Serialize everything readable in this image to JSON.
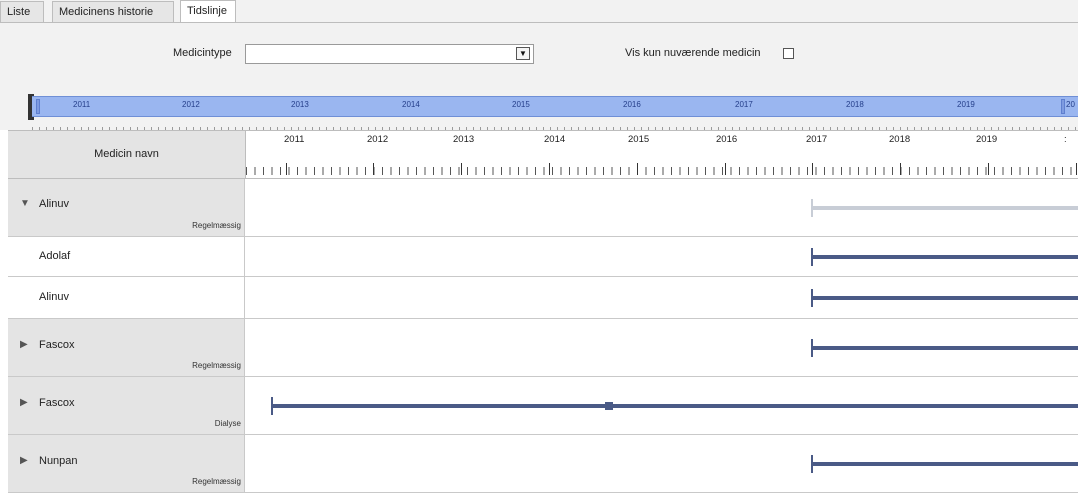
{
  "colors": {
    "bar_active": "#4a5a86",
    "bar_inactive": "#c8cdd6",
    "overview_fill": "#9ab6f0",
    "panel_bg": "#f2f2f2",
    "group_label_bg": "#e4e4e4"
  },
  "tabs": [
    {
      "label": "Liste",
      "active": false
    },
    {
      "label": "Medicinens historie",
      "active": false
    },
    {
      "label": "Tidslinje",
      "active": true
    }
  ],
  "filter": {
    "medicintype_label": "Medicintype",
    "medicintype_value": "",
    "select_arrow_icon": "▼",
    "vis_kun_label": "Vis kun nuværende medicin",
    "vis_kun_checked": false
  },
  "overview": {
    "years": [
      "2011",
      "2012",
      "2013",
      "2014",
      "2015",
      "2016",
      "2017",
      "2018",
      "2019",
      "20"
    ]
  },
  "grid": {
    "header_title": "Medicin navn",
    "axis_years": [
      "2011",
      "2012",
      "2013",
      "2014",
      "2015",
      "2016",
      "2017",
      "2018",
      "2019",
      ":"
    ]
  },
  "rows": [
    {
      "kind": "group",
      "expanded": true,
      "toggle": "▼",
      "name": "Alinuv",
      "type": "Regelmæssig",
      "start_year": 2017.0,
      "active": false
    },
    {
      "kind": "child",
      "name": "Adolaf",
      "type": "",
      "start_year": 2017.0,
      "active": true
    },
    {
      "kind": "child",
      "name": "Alinuv",
      "type": "",
      "start_year": 2017.0,
      "active": true
    },
    {
      "kind": "group",
      "expanded": false,
      "toggle": "▶",
      "name": "Fascox",
      "type": "Regelmæssig",
      "start_year": 2017.0,
      "active": true
    },
    {
      "kind": "group",
      "expanded": false,
      "toggle": "▶",
      "name": "Fascox",
      "type": "Dialyse",
      "start_year": 2010.85,
      "marker_year": 2014.7,
      "active": true
    },
    {
      "kind": "group",
      "expanded": false,
      "toggle": "▶",
      "name": "Nunpan",
      "type": "Regelmæssig",
      "start_year": 2017.0,
      "active": true
    }
  ]
}
